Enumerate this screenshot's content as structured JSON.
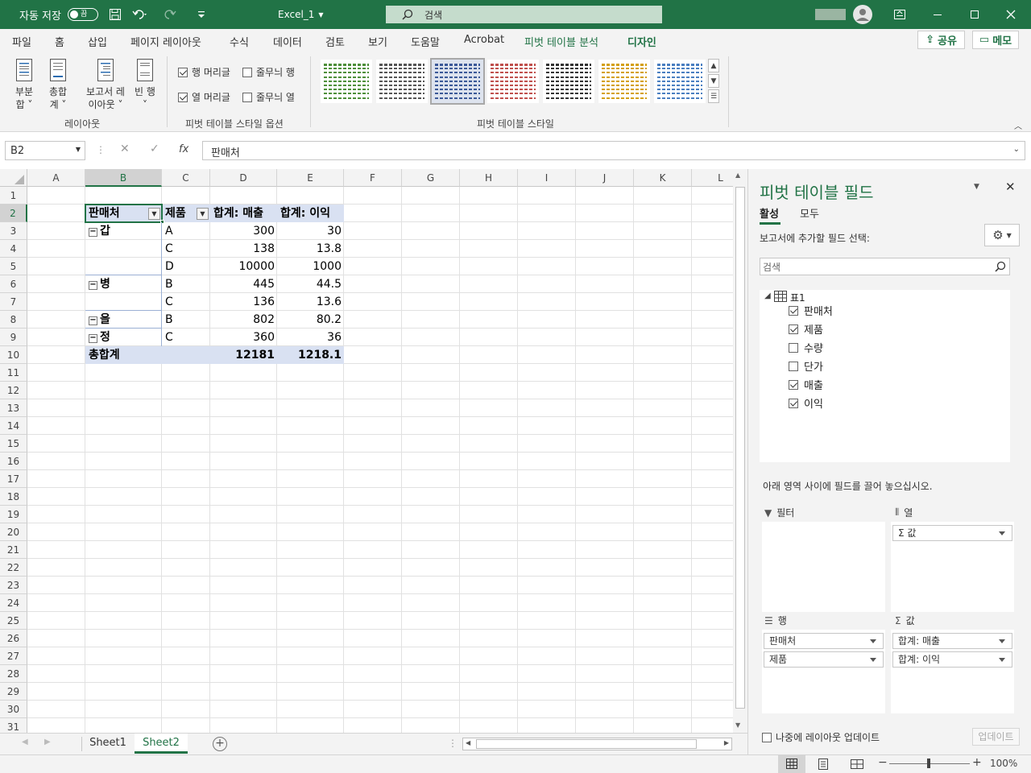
{
  "titlebar": {
    "autosave_label": "자동 저장",
    "autosave_state": "끔",
    "file_name": "Excel_1",
    "search_placeholder": "검색"
  },
  "tabs": [
    "파일",
    "홈",
    "삽입",
    "페이지 레이아웃",
    "수식",
    "데이터",
    "검토",
    "보기",
    "도움말",
    "Acrobat",
    "피벗 테이블 분석",
    "디자인"
  ],
  "share": {
    "share_label": "공유",
    "memo_label": "메모"
  },
  "ribbon": {
    "layout": {
      "subtotal_l1": "부분",
      "subtotal_l2": "합",
      "grand_l1": "총합",
      "grand_l2": "계",
      "report_l1": "보고서 레",
      "report_l2": "이아웃",
      "blank_l1": "빈 행",
      "group_label": "레이아웃"
    },
    "options": {
      "row_headers": "행 머리글",
      "banded_rows": "줄무늬 행",
      "col_headers": "열 머리글",
      "banded_cols": "줄무늬 열",
      "group_label": "피벗 테이블 스타일 옵션"
    },
    "styles": {
      "group_label": "피벗 테이블 스타일"
    }
  },
  "formula_bar": {
    "name_box": "B2",
    "fx": "fx",
    "content": "판매처"
  },
  "grid": {
    "columns": [
      "A",
      "B",
      "C",
      "D",
      "E",
      "F",
      "G",
      "H",
      "I",
      "J",
      "K",
      "L"
    ],
    "rows": [
      "1",
      "2",
      "3",
      "4",
      "5",
      "6",
      "7",
      "8",
      "9",
      "10",
      "11",
      "12",
      "13",
      "14",
      "15",
      "16",
      "17",
      "18",
      "19",
      "20",
      "21",
      "22",
      "23",
      "24",
      "25",
      "26",
      "27",
      "28",
      "29",
      "30",
      "31"
    ]
  },
  "pivot": {
    "headers": {
      "seller": "판매처",
      "product": "제품",
      "sum_sales": "합계: 매출",
      "sum_profit": "합계: 이익"
    },
    "rows": [
      {
        "seller": "갑",
        "product": "A",
        "sales": "300",
        "profit": "30"
      },
      {
        "seller": "",
        "product": "C",
        "sales": "138",
        "profit": "13.8"
      },
      {
        "seller": "",
        "product": "D",
        "sales": "10000",
        "profit": "1000"
      },
      {
        "seller": "병",
        "product": "B",
        "sales": "445",
        "profit": "44.5"
      },
      {
        "seller": "",
        "product": "C",
        "sales": "136",
        "profit": "13.6"
      },
      {
        "seller": "을",
        "product": "B",
        "sales": "802",
        "profit": "80.2"
      },
      {
        "seller": "정",
        "product": "C",
        "sales": "360",
        "profit": "36"
      }
    ],
    "total": {
      "label": "총합계",
      "sales": "12181",
      "profit": "1218.1"
    }
  },
  "sheets": [
    "Sheet1",
    "Sheet2"
  ],
  "pane": {
    "title": "피벗 테이블 필드",
    "tab_active": "활성",
    "tab_all": "모두",
    "choose_label": "보고서에 추가할 필드 선택:",
    "search_placeholder": "검색",
    "table_name": "표1",
    "fields": [
      {
        "name": "판매처",
        "checked": true
      },
      {
        "name": "제품",
        "checked": true
      },
      {
        "name": "수량",
        "checked": false
      },
      {
        "name": "단가",
        "checked": false
      },
      {
        "name": "매출",
        "checked": true
      },
      {
        "name": "이익",
        "checked": true
      }
    ],
    "drag_hint": "아래 영역 사이에 필드를 끌어 놓으십시오.",
    "areas": {
      "filter": "필터",
      "columns": "열",
      "rows": "행",
      "values": "값",
      "columns_items": [
        "Σ 값"
      ],
      "rows_items": [
        "판매처",
        "제품"
      ],
      "values_items": [
        "합계: 매출",
        "합계: 이익"
      ]
    },
    "defer_label": "나중에 레이아웃 업데이트",
    "update_label": "업데이트"
  },
  "status": {
    "zoom": "100%"
  }
}
